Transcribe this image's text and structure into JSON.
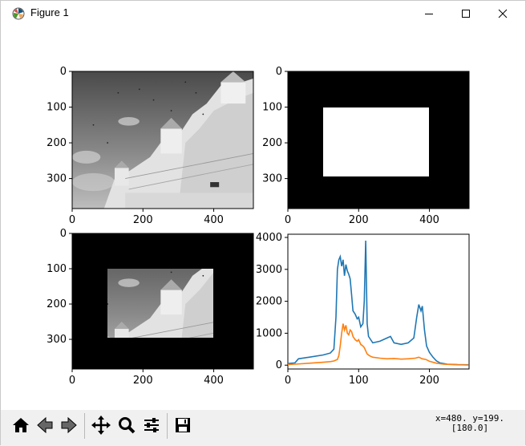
{
  "window": {
    "title": "Figure 1",
    "icon": "matplotlib-figure-icon",
    "controls": [
      "minimize-icon",
      "maximize-icon",
      "close-icon"
    ]
  },
  "toolbar": {
    "buttons": [
      "home-icon",
      "back-arrow-icon",
      "forward-arrow-icon",
      "pan-icon",
      "zoom-icon",
      "configure-subplots-icon",
      "save-icon"
    ],
    "status_line1": "x=480. y=199.",
    "status_line2": "[180.0]"
  },
  "chart_data": [
    {
      "type": "image",
      "subplot": "grayscale-photo",
      "content": "grayscale photo of ornate building with birds in sky",
      "xticks": [
        "0",
        "200",
        "400"
      ],
      "yticks": [
        "0",
        "100",
        "200",
        "300"
      ],
      "xlim": [
        0,
        512
      ],
      "ylim": [
        384,
        0
      ]
    },
    {
      "type": "image",
      "subplot": "mask",
      "content": "binary mask: white rectangle x 100-400, y 100-300 on black",
      "xticks": [
        "0",
        "200",
        "400"
      ],
      "yticks": [
        "0",
        "100",
        "200",
        "300"
      ],
      "xlim": [
        0,
        512
      ],
      "ylim": [
        384,
        0
      ]
    },
    {
      "type": "image",
      "subplot": "masked-photo",
      "content": "photo visible only inside mask rectangle, black elsewhere",
      "xticks": [
        "0",
        "200",
        "400"
      ],
      "yticks": [
        "0",
        "100",
        "200",
        "300"
      ],
      "xlim": [
        0,
        512
      ],
      "ylim": [
        384,
        0
      ]
    },
    {
      "type": "line",
      "subplot": "histogram",
      "xticks": [
        "0",
        "100",
        "200"
      ],
      "yticks": [
        "0",
        "1000",
        "2000",
        "3000",
        "4000"
      ],
      "xlim": [
        0,
        256
      ],
      "ylim": [
        -120,
        4100
      ],
      "series": [
        {
          "color": "#1f77b4",
          "x": [
            0,
            10,
            15,
            30,
            50,
            60,
            65,
            68,
            70,
            72,
            74,
            76,
            78,
            80,
            82,
            84,
            86,
            88,
            90,
            92,
            95,
            98,
            100,
            103,
            106,
            108,
            110,
            112,
            114,
            120,
            130,
            140,
            145,
            150,
            160,
            170,
            178,
            182,
            185,
            188,
            190,
            193,
            196,
            200,
            205,
            210,
            215,
            225,
            240,
            255
          ],
          "y": [
            50,
            70,
            200,
            250,
            320,
            380,
            500,
            1500,
            3000,
            3300,
            3400,
            3100,
            3300,
            2800,
            3150,
            2950,
            2850,
            2700,
            2200,
            1700,
            1600,
            1450,
            1500,
            1200,
            1300,
            2000,
            3900,
            1300,
            900,
            700,
            750,
            850,
            900,
            700,
            650,
            700,
            850,
            1500,
            1900,
            1700,
            1850,
            1100,
            600,
            400,
            250,
            130,
            70,
            30,
            15,
            10
          ]
        },
        {
          "color": "#ff7f0e",
          "x": [
            0,
            10,
            30,
            50,
            60,
            65,
            70,
            72,
            74,
            76,
            78,
            80,
            82,
            84,
            86,
            88,
            90,
            92,
            95,
            98,
            100,
            103,
            106,
            108,
            110,
            112,
            115,
            120,
            130,
            140,
            150,
            160,
            170,
            180,
            185,
            190,
            195,
            200,
            210,
            220,
            240,
            255
          ],
          "y": [
            20,
            30,
            60,
            90,
            110,
            130,
            180,
            300,
            600,
            1000,
            1300,
            1100,
            1250,
            1000,
            950,
            1100,
            1050,
            900,
            800,
            750,
            800,
            650,
            600,
            550,
            450,
            350,
            300,
            250,
            220,
            200,
            210,
            190,
            200,
            220,
            250,
            200,
            180,
            120,
            60,
            30,
            10,
            5
          ]
        }
      ]
    }
  ]
}
